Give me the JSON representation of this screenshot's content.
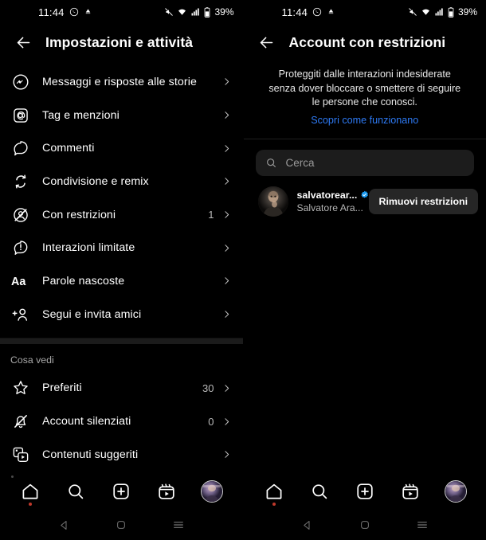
{
  "status_bar": {
    "time": "11:44",
    "left_icons": [
      "whatsapp-icon",
      "alarm-icon"
    ],
    "right_icons": [
      "mute-icon",
      "wifi-icon",
      "signal-icon",
      "battery-icon"
    ],
    "battery": "39%"
  },
  "left_panel": {
    "header": {
      "back": "back-arrow",
      "title": "Impostazioni e attività"
    },
    "items": [
      {
        "icon": "messenger-icon",
        "label": "Messaggi e risposte alle storie",
        "count": ""
      },
      {
        "icon": "at-mention-icon",
        "label": "Tag e menzioni",
        "count": ""
      },
      {
        "icon": "comment-icon",
        "label": "Commenti",
        "count": ""
      },
      {
        "icon": "share-remix-icon",
        "label": "Condivisione e remix",
        "count": ""
      },
      {
        "icon": "restricted-icon",
        "label": "Con restrizioni",
        "count": "1"
      },
      {
        "icon": "limited-icon",
        "label": "Interazioni limitate",
        "count": ""
      },
      {
        "icon": "hidden-words-icon",
        "label": "Parole nascoste",
        "count": ""
      },
      {
        "icon": "add-friend-icon",
        "label": "Segui e invita amici",
        "count": ""
      }
    ],
    "section_title": "Cosa vedi",
    "section_items": [
      {
        "icon": "star-icon",
        "label": "Preferiti",
        "count": "30"
      },
      {
        "icon": "mute-bell-icon",
        "label": "Account silenziati",
        "count": "0"
      },
      {
        "icon": "suggested-media-icon",
        "label": "Contenuti suggeriti",
        "count": ""
      }
    ]
  },
  "right_panel": {
    "header": {
      "back": "back-arrow",
      "title": "Account con restrizioni"
    },
    "intro": {
      "line1": "Proteggiti dalle interazioni indesiderate",
      "line2": "senza dover bloccare o smettere di seguire",
      "line3": "le persone che conosci.",
      "link": "Scopri come funzionano",
      "link_color": "#2e7bf6"
    },
    "search": {
      "icon": "search-icon",
      "placeholder": "Cerca",
      "value": ""
    },
    "restricted_accounts": [
      {
        "avatar": "user-avatar",
        "username": "salvatorear...",
        "verified": true,
        "full_name": "Salvatore Ara...",
        "action_label": "Rimuovi restrizioni"
      }
    ]
  },
  "tab_bar": {
    "items": [
      {
        "icon": "home-icon",
        "label": "Home",
        "active": true,
        "badge": true
      },
      {
        "icon": "search-icon",
        "label": "Cerca",
        "active": false,
        "badge": false
      },
      {
        "icon": "create-icon",
        "label": "Crea",
        "active": false,
        "badge": false
      },
      {
        "icon": "reels-icon",
        "label": "Reels",
        "active": false,
        "badge": false
      },
      {
        "icon": "profile-avatar-icon",
        "label": "Profilo",
        "active": false,
        "badge": false
      }
    ]
  },
  "system_nav": {
    "items": [
      "back-triangle-icon",
      "home-square-icon",
      "recents-menu-icon"
    ]
  },
  "colors": {
    "background": "#000000",
    "surface": "#1c1c1c",
    "button": "#262626",
    "divider": "#1b1b1b",
    "link": "#2e7bf6",
    "verified_blue": "#1d9bf0",
    "secondary_text": "#b5b5b5",
    "badge_red": "#c0392b"
  }
}
